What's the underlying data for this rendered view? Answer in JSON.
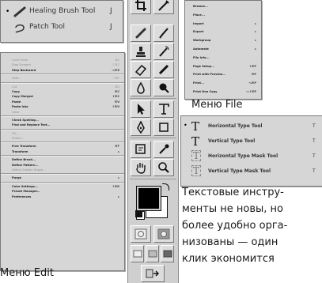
{
  "healing_menu": {
    "items": [
      {
        "label": "Healing Brush Tool",
        "shortcut": "J",
        "active": true
      },
      {
        "label": "Patch Tool",
        "shortcut": "J",
        "active": false
      }
    ]
  },
  "file_menu": {
    "caption": "Меню File",
    "items": [
      {
        "label": "Browse...",
        "shortcut": ""
      },
      {
        "label": "Place...",
        "shortcut": ""
      },
      {
        "label": "Import",
        "shortcut": "▸"
      },
      {
        "label": "Export",
        "shortcut": "▸"
      },
      {
        "label": "Workgroup",
        "shortcut": "▸"
      },
      {
        "label": "Automate",
        "shortcut": "▸"
      },
      {
        "label": "File Info...",
        "shortcut": ""
      },
      {
        "label": "Page Setup...",
        "shortcut": "⇧⌘P"
      },
      {
        "label": "Print with Preview...",
        "shortcut": "⌘P"
      },
      {
        "label": "Print...",
        "shortcut": "⌥⌘P"
      },
      {
        "label": "Print One Copy",
        "shortcut": "⌥⇧⌘P"
      }
    ]
  },
  "edit_menu": {
    "caption": "Меню Edit",
    "items": [
      {
        "label": "Can't Undo",
        "shortcut": "⌘Z",
        "disabled": true
      },
      {
        "label": "Step Forward",
        "shortcut": "⇧⌘Z",
        "disabled": true
      },
      {
        "label": "Step Backward",
        "shortcut": "⌥⌘Z",
        "disabled": false
      },
      {
        "sep": true
      },
      {
        "label": "Fade...",
        "shortcut": "⇧⌘F",
        "disabled": true
      },
      {
        "sep": true
      },
      {
        "label": "Cut",
        "shortcut": "⌘X",
        "disabled": true
      },
      {
        "label": "Copy",
        "shortcut": "⌘C",
        "disabled": false
      },
      {
        "label": "Copy Merged",
        "shortcut": "⇧⌘C",
        "disabled": false
      },
      {
        "label": "Paste",
        "shortcut": "⌘V",
        "disabled": false
      },
      {
        "label": "Paste Into",
        "shortcut": "⇧⌘V",
        "disabled": false
      },
      {
        "label": "Clear",
        "shortcut": "",
        "disabled": true
      },
      {
        "sep": true
      },
      {
        "label": "Check Spelling...",
        "shortcut": "",
        "disabled": false
      },
      {
        "label": "Find and Replace Text...",
        "shortcut": "",
        "disabled": false
      },
      {
        "sep": true
      },
      {
        "label": "Fill...",
        "shortcut": "",
        "disabled": true
      },
      {
        "label": "Stroke...",
        "shortcut": "",
        "disabled": true
      },
      {
        "sep": true
      },
      {
        "label": "Free Transform",
        "shortcut": "⌘T",
        "disabled": false
      },
      {
        "label": "Transform",
        "shortcut": "▸",
        "disabled": false
      },
      {
        "sep": true
      },
      {
        "label": "Define Brush...",
        "shortcut": "",
        "disabled": false
      },
      {
        "label": "Define Pattern...",
        "shortcut": "",
        "disabled": false
      },
      {
        "label": "Define Custom Shape...",
        "shortcut": "",
        "disabled": true
      },
      {
        "sep": true
      },
      {
        "label": "Purge",
        "shortcut": "▸",
        "disabled": false
      },
      {
        "sep": true
      },
      {
        "label": "Color Settings...",
        "shortcut": "⇧⌘K",
        "disabled": false
      },
      {
        "label": "Preset Manager...",
        "shortcut": "",
        "disabled": false
      },
      {
        "label": "Preferences",
        "shortcut": "▸",
        "disabled": false
      }
    ]
  },
  "type_menu": {
    "items": [
      {
        "label": "Horizontal Type Tool",
        "shortcut": "T",
        "active": true
      },
      {
        "label": "Vertical Type Tool",
        "shortcut": "T",
        "active": false
      },
      {
        "label": "Horizontal Type Mask Tool",
        "shortcut": "T",
        "active": false
      },
      {
        "label": "Vertical Type Mask Tool",
        "shortcut": "T",
        "active": false
      }
    ]
  },
  "body_text": [
    "Текстовые инстру-",
    "менты не новы, но",
    "более удобно орга-",
    "низованы — один",
    "клик экономится"
  ],
  "colors": {
    "menu_bg": "#d6d6d6",
    "toolbar_bg": "#cfcfcf",
    "text": "#1a1a1a"
  }
}
